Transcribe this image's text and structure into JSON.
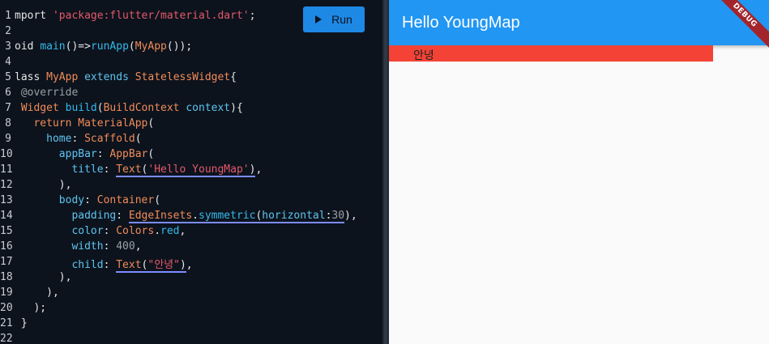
{
  "editor": {
    "run_label": "Run",
    "line_numbers": [
      "1",
      "2",
      "3",
      "4",
      "5",
      "6",
      "7",
      "8",
      "9",
      "10",
      "11",
      "12",
      "13",
      "14",
      "15",
      "16",
      "17",
      "18",
      "19",
      "20",
      "21",
      "22"
    ],
    "code": {
      "l1_a": "mport ",
      "l1_b": "'package:flutter/material.dart'",
      "l1_c": ";",
      "l3_a": "oid ",
      "l3_b": "main",
      "l3_c": "()=>",
      "l3_d": "runApp",
      "l3_e": "(",
      "l3_f": "MyApp",
      "l3_g": "());",
      "l5_a": "lass ",
      "l5_b": "MyApp",
      "l5_c": " extends ",
      "l5_d": "StatelessWidget",
      "l5_e": "{",
      "l6": " @override",
      "l7_a": " Widget ",
      "l7_b": "build",
      "l7_c": "(",
      "l7_d": "BuildContext",
      "l7_e": " context",
      "l7_f": "){",
      "l8_a": "   return ",
      "l8_b": "MaterialApp",
      "l8_c": "(",
      "l9_a": "     home",
      "l9_b": ": ",
      "l9_c": "Scaffold",
      "l9_d": "(",
      "l10_a": "       appBar",
      "l10_b": ": ",
      "l10_c": "AppBar",
      "l10_d": "(",
      "l11_a": "         title",
      "l11_b": ": ",
      "l11_c": "Text",
      "l11_d": "(",
      "l11_e": "'Hello YoungMap'",
      "l11_f": "),",
      "l12": "       ),",
      "l13_a": "       body",
      "l13_b": ": ",
      "l13_c": "Container",
      "l13_d": "(",
      "l14_a": "         padding",
      "l14_b": ": ",
      "l14_c": "EdgeInsets",
      "l14_d": ".",
      "l14_e": "symmetric",
      "l14_f": "(",
      "l14_g": "horizontal",
      "l14_h": ":",
      "l14_i": "30",
      "l14_j": "),",
      "l15_a": "         color",
      "l15_b": ": ",
      "l15_c": "Colors",
      "l15_d": ".",
      "l15_e": "red",
      "l15_f": ",",
      "l16_a": "         width",
      "l16_b": ": ",
      "l16_c": "400",
      "l16_d": ",",
      "l17_a": "         child",
      "l17_b": ": ",
      "l17_c": "Text",
      "l17_d": "(",
      "l17_e": "\"안녕\"",
      "l17_f": "),",
      "l18": "       ),",
      "l19": "     ),",
      "l20": "   );",
      "l21": " }"
    }
  },
  "preview": {
    "appbar_title": "Hello YoungMap",
    "body_text": "안녕",
    "debug_banner": "DEBUG"
  },
  "colors": {
    "editor_bg": "#0c131d",
    "run_button": "#1e88e5",
    "appbar": "#2196f3",
    "container_red": "#f44336",
    "debug_banner": "#a3252b"
  }
}
